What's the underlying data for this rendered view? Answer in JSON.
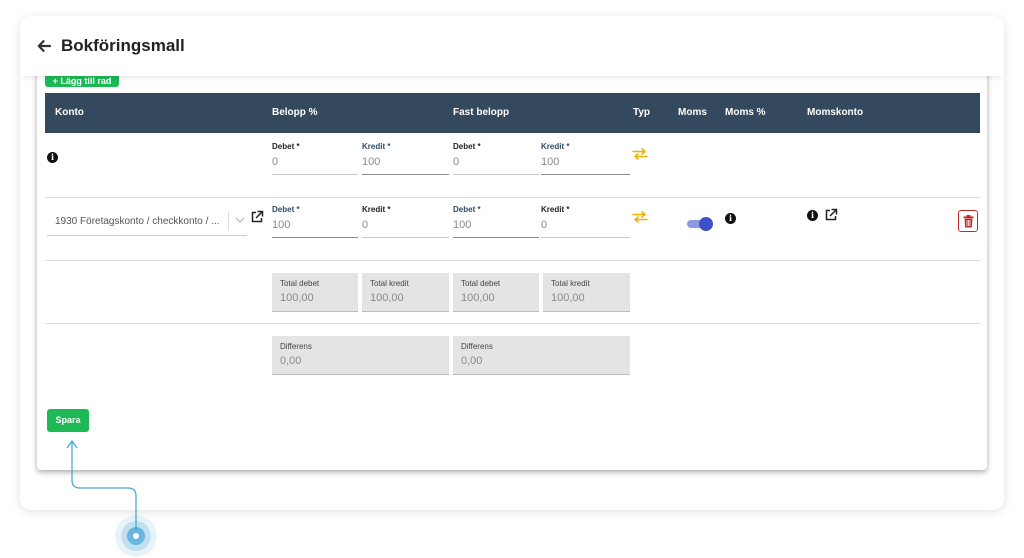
{
  "header": {
    "title": "Bokföringsmall"
  },
  "toolbar": {
    "add_row_label": "+ Lägg till rad"
  },
  "table": {
    "columns": {
      "konto": "Konto",
      "belopp": "Belopp %",
      "fast_belopp": "Fast belopp",
      "typ": "Typ",
      "moms": "Moms",
      "moms_pct": "Moms %",
      "momskonto": "Momskonto"
    },
    "row1": {
      "belopp_debet_label": "Debet *",
      "belopp_debet_value": "0",
      "belopp_kredit_label": "Kredit *",
      "belopp_kredit_value": "100",
      "fast_debet_label": "Debet *",
      "fast_debet_value": "0",
      "fast_kredit_label": "Kredit *",
      "fast_kredit_value": "100"
    },
    "row2": {
      "account": "1930 Företagskonto / checkkonto / ...",
      "belopp_debet_label": "Debet *",
      "belopp_debet_value": "100",
      "belopp_kredit_label": "Kredit *",
      "belopp_kredit_value": "0",
      "fast_debet_label": "Debet *",
      "fast_debet_value": "100",
      "fast_kredit_label": "Kredit *",
      "fast_kredit_value": "0",
      "moms_enabled": true
    }
  },
  "totals": [
    {
      "label": "Total debet",
      "value": "100,00"
    },
    {
      "label": "Total kredit",
      "value": "100,00"
    },
    {
      "label": "Total debet",
      "value": "100,00"
    },
    {
      "label": "Total kredit",
      "value": "100,00"
    }
  ],
  "differences": [
    {
      "label": "Differens",
      "value": "0,00"
    },
    {
      "label": "Differens",
      "value": "0,00"
    }
  ],
  "actions": {
    "save_label": "Spara"
  },
  "colors": {
    "header_bg": "#34495e",
    "primary_green": "#1db954",
    "swap_icon": "#f0b400",
    "delete_red": "#c62828",
    "toggle_on": "#3f51c6",
    "blue_label": "#2d4a6a"
  }
}
